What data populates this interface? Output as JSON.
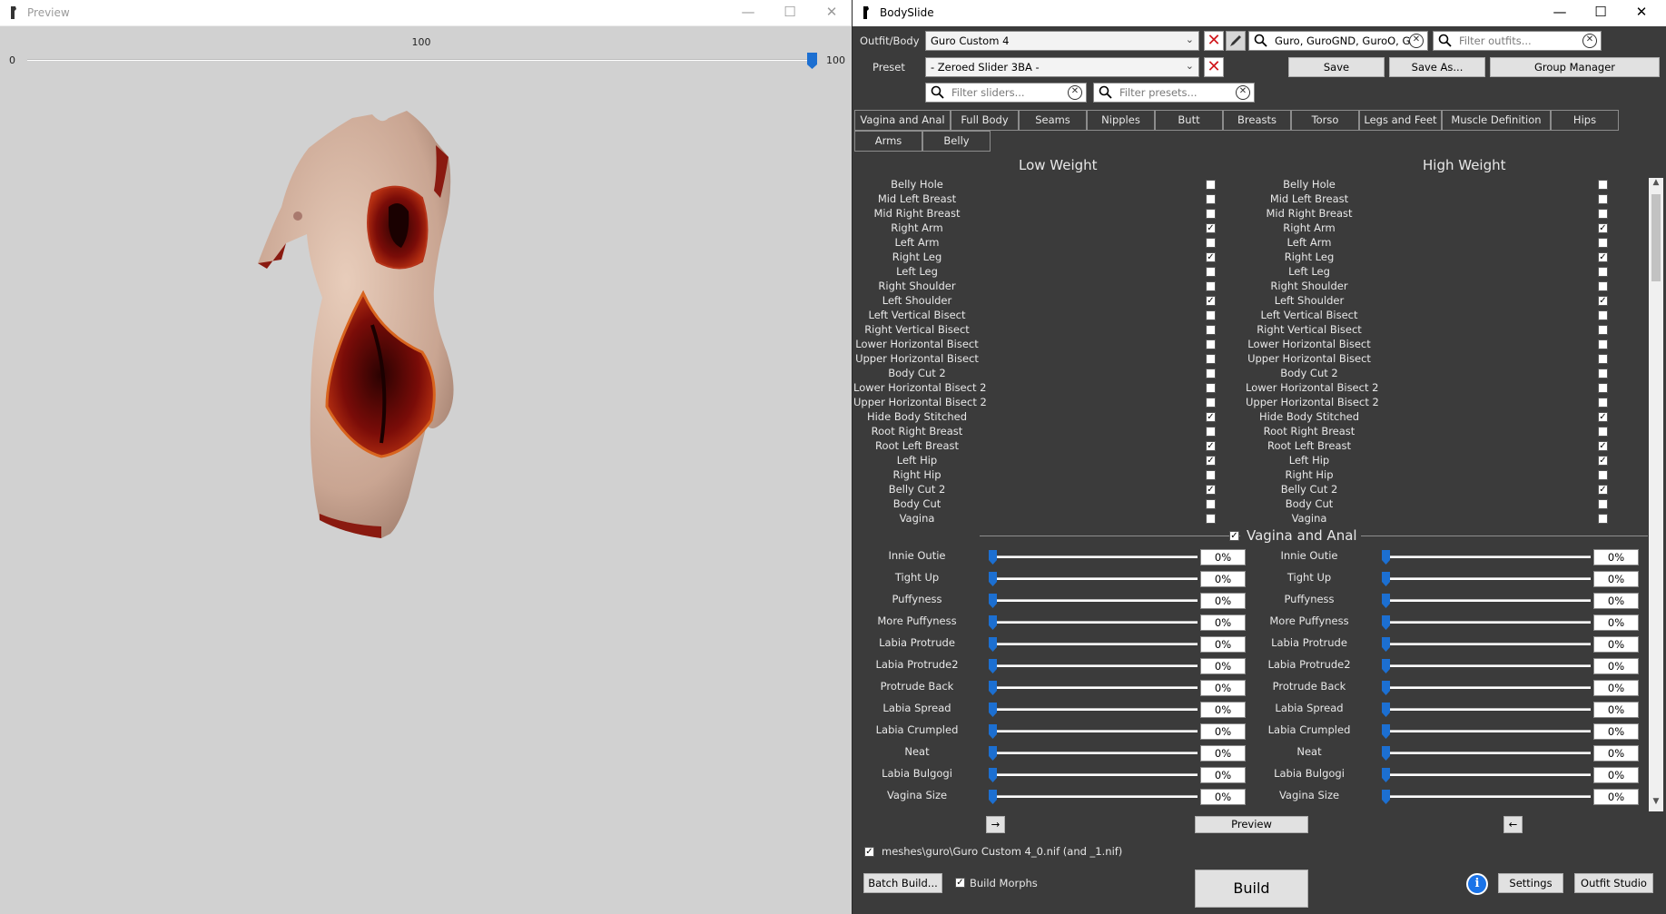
{
  "preview": {
    "title": "Preview",
    "slider": {
      "value": "100",
      "min": "0",
      "max": "100",
      "level": 1.0
    },
    "window_buttons": {
      "minimize": "—",
      "maximize": "☐",
      "close": "✕"
    }
  },
  "bodyslide": {
    "title": "BodySlide",
    "window_buttons": {
      "minimize": "—",
      "maximize": "☐",
      "close": "✕"
    },
    "outfit_label": "Outfit/Body",
    "outfit_value": "Guro Custom 4",
    "outfit_group_filter": "Guro, GuroGND, GuroO, G",
    "outfit_filter_placeholder": "Filter outfits...",
    "preset_label": "Preset",
    "preset_value": "- Zeroed Slider 3BA -",
    "save_label": "Save",
    "save_as_label": "Save As...",
    "group_manager_label": "Group Manager",
    "slider_filter_placeholder": "Filter sliders...",
    "preset_filter_placeholder": "Filter presets...",
    "tabs": [
      {
        "label": "Vagina and Anal"
      },
      {
        "label": "Full Body"
      },
      {
        "label": "Seams"
      },
      {
        "label": "Nipples"
      },
      {
        "label": "Butt"
      },
      {
        "label": "Breasts"
      },
      {
        "label": "Torso"
      },
      {
        "label": "Legs and Feet"
      },
      {
        "label": "Muscle Definition"
      },
      {
        "label": "Hips"
      },
      {
        "label": "Arms"
      },
      {
        "label": "Belly"
      }
    ],
    "low_weight_label": "Low Weight",
    "high_weight_label": "High Weight",
    "zap_rows": [
      {
        "label": "Belly Hole",
        "low": false,
        "high": false
      },
      {
        "label": "Mid Left Breast",
        "low": false,
        "high": false
      },
      {
        "label": "Mid Right Breast",
        "low": false,
        "high": false
      },
      {
        "label": "Right Arm",
        "low": true,
        "high": true
      },
      {
        "label": "Left Arm",
        "low": false,
        "high": false
      },
      {
        "label": "Right Leg",
        "low": true,
        "high": true
      },
      {
        "label": "Left Leg",
        "low": false,
        "high": false
      },
      {
        "label": "Right Shoulder",
        "low": false,
        "high": false
      },
      {
        "label": "Left Shoulder",
        "low": true,
        "high": true
      },
      {
        "label": "Left Vertical Bisect",
        "low": false,
        "high": false
      },
      {
        "label": "Right Vertical Bisect",
        "low": false,
        "high": false
      },
      {
        "label": "Lower Horizontal Bisect",
        "low": false,
        "high": false
      },
      {
        "label": "Upper Horizontal Bisect",
        "low": false,
        "high": false
      },
      {
        "label": "Body Cut 2",
        "low": false,
        "high": false
      },
      {
        "label": "Lower Horizontal Bisect 2",
        "low": false,
        "high": false
      },
      {
        "label": "Upper Horizontal Bisect 2",
        "low": false,
        "high": false
      },
      {
        "label": "Hide Body Stitched",
        "low": true,
        "high": true
      },
      {
        "label": "Root Right Breast",
        "low": false,
        "high": false
      },
      {
        "label": "Root Left Breast",
        "low": true,
        "high": true
      },
      {
        "label": "Left Hip",
        "low": true,
        "high": true
      },
      {
        "label": "Right Hip",
        "low": false,
        "high": false
      },
      {
        "label": "Belly Cut 2",
        "low": true,
        "high": true
      },
      {
        "label": "Body Cut",
        "low": false,
        "high": false
      },
      {
        "label": "Vagina",
        "low": false,
        "high": false
      }
    ],
    "section_title": "Vagina and Anal",
    "section_checked": true,
    "sliders": [
      {
        "label": "Innie Outie",
        "low": "0%",
        "high": "0%"
      },
      {
        "label": "Tight Up",
        "low": "0%",
        "high": "0%"
      },
      {
        "label": "Puffyness",
        "low": "0%",
        "high": "0%"
      },
      {
        "label": "More Puffyness",
        "low": "0%",
        "high": "0%"
      },
      {
        "label": "Labia Protrude",
        "low": "0%",
        "high": "0%"
      },
      {
        "label": "Labia Protrude2",
        "low": "0%",
        "high": "0%"
      },
      {
        "label": "Protrude Back",
        "low": "0%",
        "high": "0%"
      },
      {
        "label": "Labia Spread",
        "low": "0%",
        "high": "0%"
      },
      {
        "label": "Labia Crumpled",
        "low": "0%",
        "high": "0%"
      },
      {
        "label": "Neat",
        "low": "0%",
        "high": "0%"
      },
      {
        "label": "Labia Bulgogi",
        "low": "0%",
        "high": "0%"
      },
      {
        "label": "Vagina Size",
        "low": "0%",
        "high": "0%"
      }
    ],
    "copy_right_label": "→",
    "preview_label": "Preview",
    "copy_left_label": "←",
    "output_path": "meshes\\guro\\Guro Custom 4_0.nif (and _1.nif)",
    "output_checked": true,
    "batch_build_label": "Batch Build...",
    "build_morphs_label": "Build Morphs",
    "build_morphs_checked": true,
    "build_label": "Build",
    "info_icon_label": "i",
    "settings_label": "Settings",
    "outfit_studio_label": "Outfit Studio"
  }
}
